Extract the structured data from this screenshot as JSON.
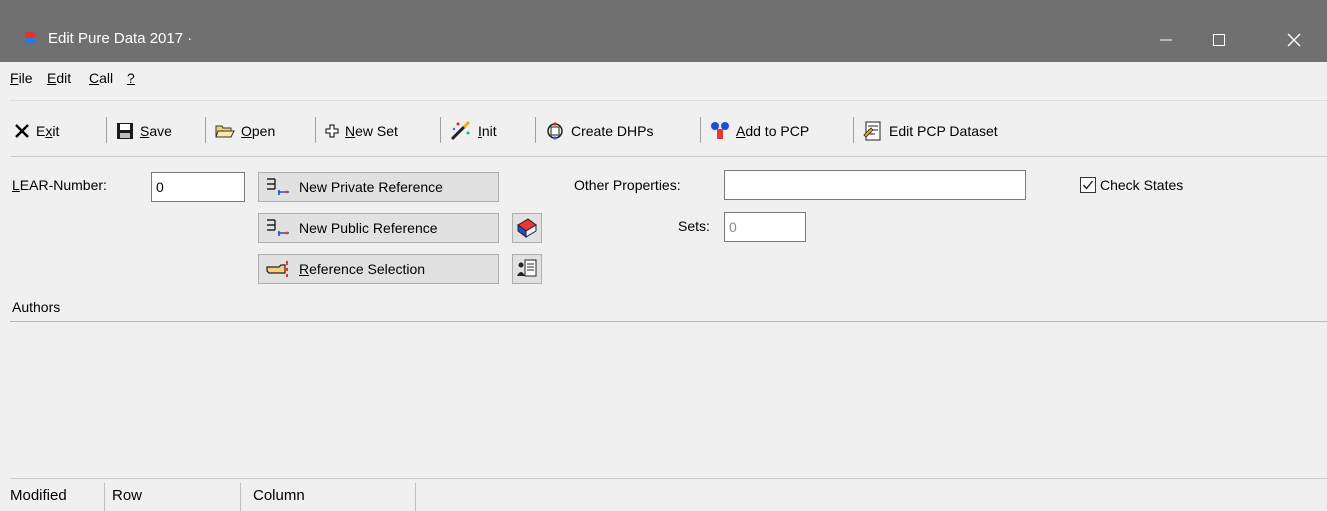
{
  "window": {
    "title": "Edit Pure Data 2017 ·",
    "controls": {
      "minimize": "—",
      "maximize": "☐",
      "close": "✕"
    },
    "accent": "#707070"
  },
  "menu": [
    {
      "key": "F",
      "rest": "ile"
    },
    {
      "key": "E",
      "rest": "dit"
    },
    {
      "key": "C",
      "rest": "all"
    },
    {
      "key": "?",
      "rest": ""
    }
  ],
  "toolbar": {
    "exit": {
      "key": "x",
      "pre": "E",
      "rest": "it",
      "icon": "x-icon"
    },
    "save": {
      "key": "S",
      "rest": "ave",
      "icon": "floppy-icon"
    },
    "open": {
      "key": "O",
      "rest": "pen",
      "icon": "folder-open-icon"
    },
    "new_set": {
      "key": "N",
      "rest": "ew Set",
      "icon": "plus-icon"
    },
    "init": {
      "key": "I",
      "rest": "nit",
      "icon": "wand-icon"
    },
    "create_dhps": {
      "label": "Create DHPs",
      "icon": "cycle-icon"
    },
    "add_to_pcp": {
      "key": "A",
      "rest": "dd to PCP",
      "icon": "molecule-icon"
    },
    "edit_pcp": {
      "label": "Edit PCP Dataset",
      "icon": "dataset-icon"
    }
  },
  "form": {
    "lear_label": {
      "key": "L",
      "rest": "EAR-Number:"
    },
    "lear_value": "0",
    "new_private_reference": "New Private Reference",
    "new_public_reference": "New Public Reference",
    "reference_selection": {
      "key": "R",
      "rest": "eference Selection"
    },
    "other_properties_label": "Other Properties:",
    "other_properties_value": "",
    "sets_label": "Sets:",
    "sets_value": "0",
    "check_states_label": "Check States",
    "check_states_checked": true,
    "authors_label": "Authors"
  },
  "statusbar": {
    "modified": "Modified",
    "row": "Row",
    "column": "Column"
  }
}
